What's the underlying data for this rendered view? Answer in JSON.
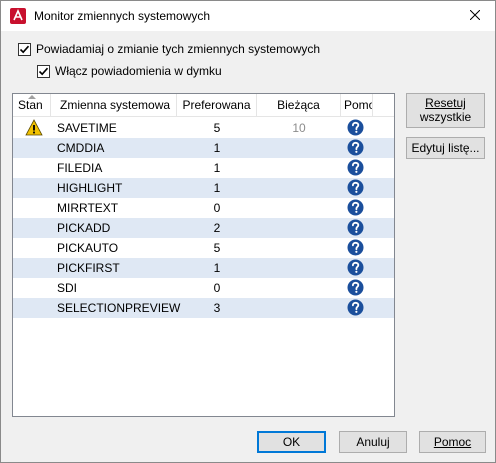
{
  "window": {
    "title": "Monitor zmiennych systemowych"
  },
  "options": {
    "notify_label": "Powiadamiaj o zmianie tych zmiennych systemowych",
    "notify_checked": true,
    "balloon_label": "Włącz powiadomienia w dymku",
    "balloon_checked": true
  },
  "table": {
    "headers": {
      "state": "Stan",
      "name": "Zmienna systemowa",
      "preferred": "Preferowana",
      "current": "Bieżąca",
      "help": "Pomoc"
    },
    "rows": [
      {
        "warning": true,
        "name": "SAVETIME",
        "preferred": "5",
        "current": "10"
      },
      {
        "warning": false,
        "name": "CMDDIA",
        "preferred": "1",
        "current": ""
      },
      {
        "warning": false,
        "name": "FILEDIA",
        "preferred": "1",
        "current": ""
      },
      {
        "warning": false,
        "name": "HIGHLIGHT",
        "preferred": "1",
        "current": ""
      },
      {
        "warning": false,
        "name": "MIRRTEXT",
        "preferred": "0",
        "current": ""
      },
      {
        "warning": false,
        "name": "PICKADD",
        "preferred": "2",
        "current": ""
      },
      {
        "warning": false,
        "name": "PICKAUTO",
        "preferred": "5",
        "current": ""
      },
      {
        "warning": false,
        "name": "PICKFIRST",
        "preferred": "1",
        "current": ""
      },
      {
        "warning": false,
        "name": "SDI",
        "preferred": "0",
        "current": ""
      },
      {
        "warning": false,
        "name": "SELECTIONPREVIEW",
        "preferred": "3",
        "current": ""
      }
    ]
  },
  "side_buttons": {
    "reset_line1": "Resetuj",
    "reset_line2": "wszystkie",
    "edit_list": "Edytuj listę..."
  },
  "footer": {
    "ok": "OK",
    "cancel": "Anuluj",
    "help": "Pomoc"
  },
  "colors": {
    "row_alt": "#dfe8f4",
    "help_icon": "#1b4f9c",
    "warning_icon": "#f2c200",
    "app_icon": "#c8102e",
    "default_button_border": "#0078d7"
  },
  "icons": {
    "app": "autocad-app-icon",
    "close": "close-icon",
    "warning": "warning-triangle-icon",
    "help": "help-question-icon",
    "checkbox": "checkmark-icon"
  }
}
